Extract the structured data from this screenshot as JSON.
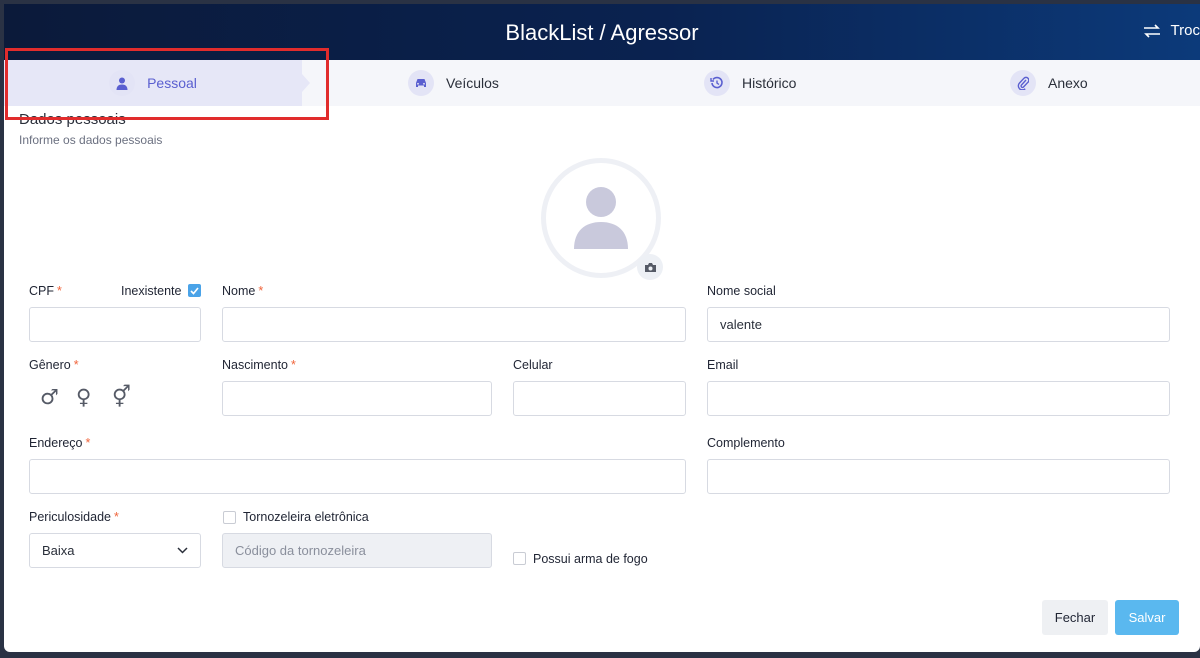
{
  "header": {
    "title": "BlackList / Agressor",
    "swap_label": "Troc"
  },
  "tabs": [
    {
      "label": "Pessoal",
      "icon": "person-icon"
    },
    {
      "label": "Veículos",
      "icon": "car-icon"
    },
    {
      "label": "Histórico",
      "icon": "history-icon"
    },
    {
      "label": "Anexo",
      "icon": "paperclip-icon"
    }
  ],
  "section": {
    "title": "Dados pessoais",
    "subtitle": "Informe os dados pessoais"
  },
  "form": {
    "cpf": {
      "label": "CPF",
      "value": ""
    },
    "inexistente": {
      "label": "Inexistente",
      "checked": true
    },
    "nome": {
      "label": "Nome",
      "value": ""
    },
    "nome_social": {
      "label": "Nome social",
      "value": "valente"
    },
    "genero": {
      "label": "Gênero",
      "options": [
        "♂",
        "♀",
        "⚥"
      ]
    },
    "nascimento": {
      "label": "Nascimento",
      "value": ""
    },
    "celular": {
      "label": "Celular",
      "value": ""
    },
    "email": {
      "label": "Email",
      "value": ""
    },
    "endereco": {
      "label": "Endereço",
      "value": ""
    },
    "complemento": {
      "label": "Complemento",
      "value": ""
    },
    "periculosidade": {
      "label": "Periculosidade",
      "value": "Baixa"
    },
    "tornozeleira": {
      "label": "Tornozeleira eletrônica",
      "checked": false,
      "placeholder": "Código da tornozeleira"
    },
    "arma": {
      "label": "Possui arma de fogo",
      "checked": false
    },
    "required_mark": "*"
  },
  "buttons": {
    "fechar": "Fechar",
    "salvar": "Salvar"
  },
  "colors": {
    "header_dark": "#0b1a3a",
    "accent": "#5a5fd0",
    "required": "#f0643b",
    "save": "#5ab8ef",
    "highlight": "#e12c2c"
  }
}
